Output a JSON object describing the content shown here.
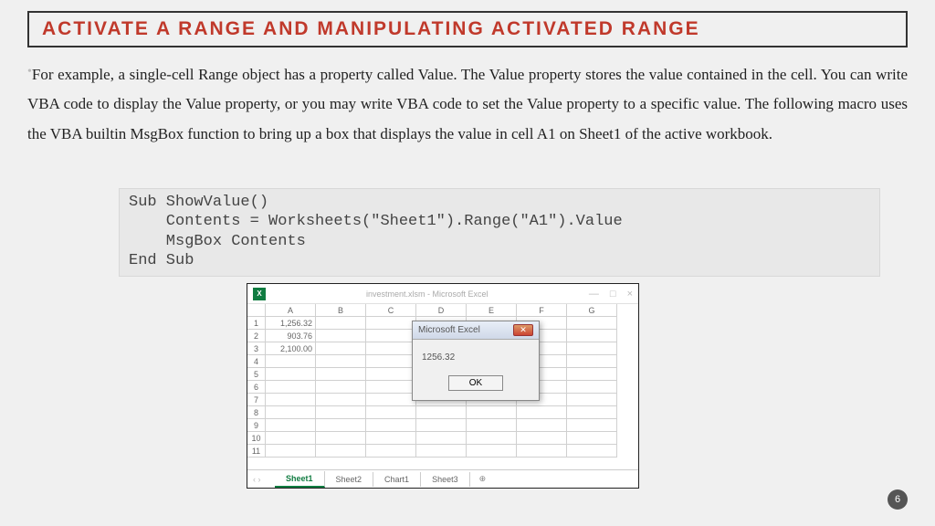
{
  "title": "ACTIVATE A RANGE AND MANIPULATING ACTIVATED RANGE",
  "body": "For example, a single-cell Range object has a property called Value. The Value property stores the value contained in the cell. You can write VBA code to display the Value property, or you may write VBA code to set the Value property to a specific value. The following macro uses the VBA builtin MsgBox function to bring up a box that displays the value in cell A1 on Sheet1 of the active workbook.",
  "code": "Sub ShowValue()\n    Contents = Worksheets(\"Sheet1\").Range(\"A1\").Value\n    MsgBox Contents\nEnd Sub",
  "excel": {
    "icon": "X",
    "window_title": "investment.xlsm - Microsoft Excel",
    "columns": [
      "A",
      "B",
      "C",
      "D",
      "E",
      "F",
      "G"
    ],
    "rows": [
      "1",
      "2",
      "3",
      "4",
      "5",
      "6",
      "7",
      "8",
      "9",
      "10",
      "11"
    ],
    "cells": {
      "A1": "1,256.32",
      "A2": "903.76",
      "A3": "2,100.00"
    },
    "tabs": {
      "nav": "‹  ›",
      "items": [
        "Sheet1",
        "Sheet2",
        "Chart1",
        "Sheet3"
      ],
      "active": 0,
      "add": "⊕"
    },
    "win_btns": [
      "—",
      "□",
      "×"
    ]
  },
  "msgbox": {
    "title": "Microsoft Excel",
    "close": "✕",
    "content": "1256.32",
    "ok": "OK"
  },
  "page_number": "6"
}
